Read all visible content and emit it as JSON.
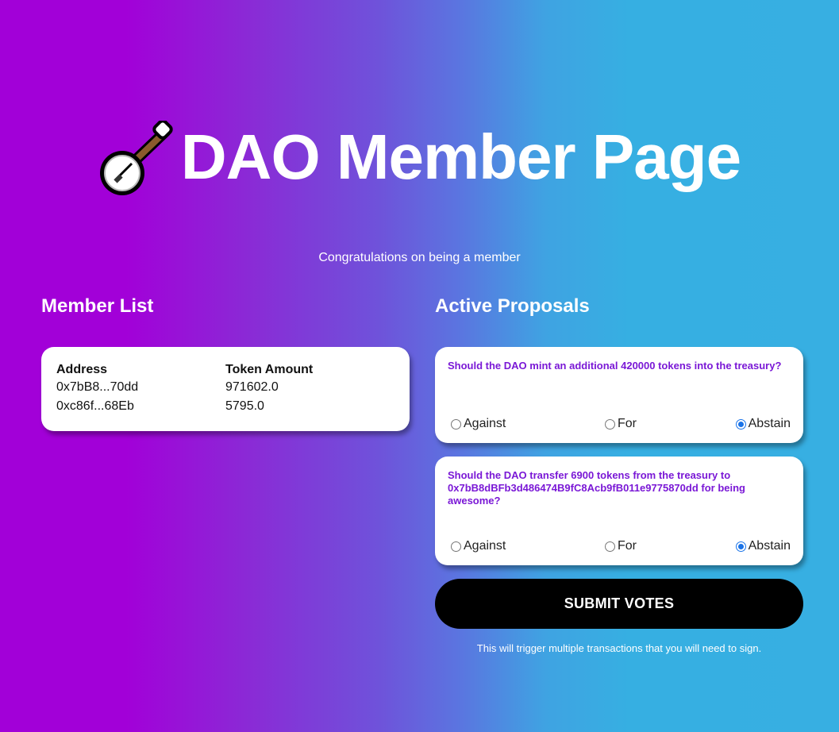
{
  "header": {
    "title": "DAO Member Page",
    "icon": "banjo-icon",
    "subtitle": "Congratulations on being a member"
  },
  "members": {
    "title": "Member List",
    "columns": [
      "Address",
      "Token Amount"
    ],
    "rows": [
      {
        "address": "0x7bB8...70dd",
        "amount": "971602.0"
      },
      {
        "address": "0xc86f...68Eb",
        "amount": "5795.0"
      }
    ]
  },
  "proposals": {
    "title": "Active Proposals",
    "items": [
      {
        "description": "Should the DAO mint an additional 420000 tokens into the treasury?",
        "options": [
          "Against",
          "For",
          "Abstain"
        ],
        "selected": "Abstain"
      },
      {
        "description": "Should the DAO transfer 6900 tokens from the treasury to 0x7bB8dBFb3d486474B9fC8Acb9fB011e9775870dd for being awesome?",
        "options": [
          "Against",
          "For",
          "Abstain"
        ],
        "selected": "Abstain"
      }
    ],
    "submit_label": "SUBMIT VOTES",
    "note": "This will trigger multiple transactions that you will need to sign."
  },
  "colors": {
    "gradient_left": "#a200d8",
    "gradient_right": "#37afe2",
    "proposal_text": "#7a18d6",
    "radio_selected": "#1a73e8"
  }
}
